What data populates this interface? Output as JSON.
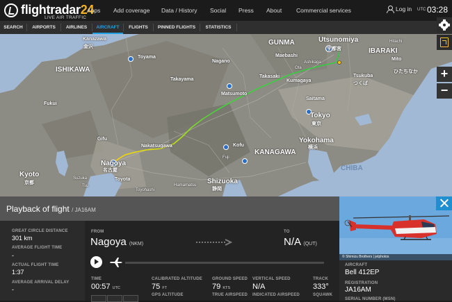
{
  "header": {
    "logo_text": "flightradar",
    "logo_number": "24",
    "logo_sub": "LIVE AIR TRAFFIC",
    "nav": [
      "Apps",
      "Add coverage",
      "Data / History",
      "Social",
      "Press",
      "About",
      "Commercial services"
    ],
    "login_label": "Log in",
    "utc_label": "UTC",
    "time": "03:28"
  },
  "subnav": {
    "items": [
      "SEARCH",
      "AIRPORTS",
      "AIRLINES",
      "AIRCRAFT",
      "FLIGHTS",
      "PINNED FLIGHTS",
      "STATISTICS"
    ],
    "active": "AIRCRAFT"
  },
  "map": {
    "labels": {
      "gunma": "GUNMA",
      "utsunomiya": "Utsunomiya",
      "utsunomiya_jp": "宇都宮",
      "ibaraki": "IBARAKI",
      "mito": "Mito",
      "hitachinaka": "ひたちなか",
      "tsukuba": "Tsukuba",
      "tsukuba_jp": "つくば",
      "takasaki": "Takasaki",
      "kanazawa": "Kanazawa",
      "kanazawa_jp": "金沢",
      "toyama": "Toyama",
      "ishikawa": "ISHIKAWA",
      "fukui": "Fukui",
      "tokyo": "Tokyo",
      "tokyo_jp": "東京",
      "yokohama": "Yokohama",
      "yokohama_jp": "横浜",
      "kanagawa": "KANAGAWA",
      "chiba": "CHIBA",
      "nagoya": "Nagoya",
      "nagoya_jp": "名古屋",
      "toyota": "Toyota",
      "gifu": "Gifu",
      "kyoto": "Kyoto",
      "kyoto_jp": "京都",
      "shizuoka": "Shizuoka",
      "shizuoka_jp": "静岡",
      "hamamatsu": "Hamamatsu",
      "nagano": "Nagano",
      "matsumoto": "Matsumoto",
      "kofu": "Kofu",
      "ota": "Ota",
      "ashikaga": "Ashikaga",
      "maebashi": "Maebashi",
      "saitama": "Saitama",
      "kumagaya": "Kumagaya",
      "fuji": "Fuji",
      "suzuka": "Suzuka",
      "tsu": "Tsu",
      "takayama": "Takayama",
      "nakatsugawa": "Nakatsugawa",
      "toyohashi": "Toyohashi",
      "hitachi": "Hitachi"
    },
    "colors": {
      "track_start": "#ffd400",
      "track_end": "#2ecc40",
      "land": "#8d8c84",
      "sea": "#a2b9d6"
    }
  },
  "controls": {
    "settings_icon": "gear-icon",
    "filter_icon": "filter-icon",
    "zoom_in": "+",
    "zoom_out": "−"
  },
  "playback": {
    "title": "Playback of flight",
    "sub": "/ JA16AM",
    "stats": {
      "great_circle_label": "GREAT CIRCLE DISTANCE",
      "great_circle_value": "301 km",
      "avg_flight_time_label": "AVERAGE FLIGHT TIME",
      "avg_flight_time_value": "-",
      "actual_flight_time_label": "ACTUAL FLIGHT TIME",
      "actual_flight_time_value": "1:37",
      "avg_arrival_delay_label": "AVERAGE ARRIVAL DELAY",
      "avg_arrival_delay_value": "-"
    },
    "from_label": "FROM",
    "from_city": "Nagoya",
    "from_code": "(NKM)",
    "to_label": "TO",
    "to_city": "N/A",
    "to_code": "(QUT)",
    "progress": 0,
    "time_label": "TIME",
    "time_value": "00:57",
    "time_unit": "UTC",
    "cal_alt_label": "CALIBRATED ALTITUDE",
    "cal_alt_value": "75",
    "cal_alt_unit": "FT",
    "gps_alt_label": "GPS ALTITUDE",
    "ground_speed_label": "GROUND SPEED",
    "ground_speed_value": "79",
    "ground_speed_unit": "KTS",
    "true_airspeed_label": "TRUE AIRSPEED",
    "vertical_speed_label": "VERTICAL SPEED",
    "vertical_speed_value": "N/A",
    "indicated_airspeed_label": "INDICATED AIRSPEED",
    "track_label": "TRACK",
    "track_value": "333°",
    "squawk_label": "SQUAWK"
  },
  "aircraft": {
    "photo_credit": "© Shimizu Brothers | jetphotos",
    "aircraft_label": "AIRCRAFT",
    "aircraft_value": "Bell 412EP",
    "registration_label": "REGISTRATION",
    "registration_value": "JA16AM",
    "serial_label": "SERIAL NUMBER (MSN)"
  }
}
